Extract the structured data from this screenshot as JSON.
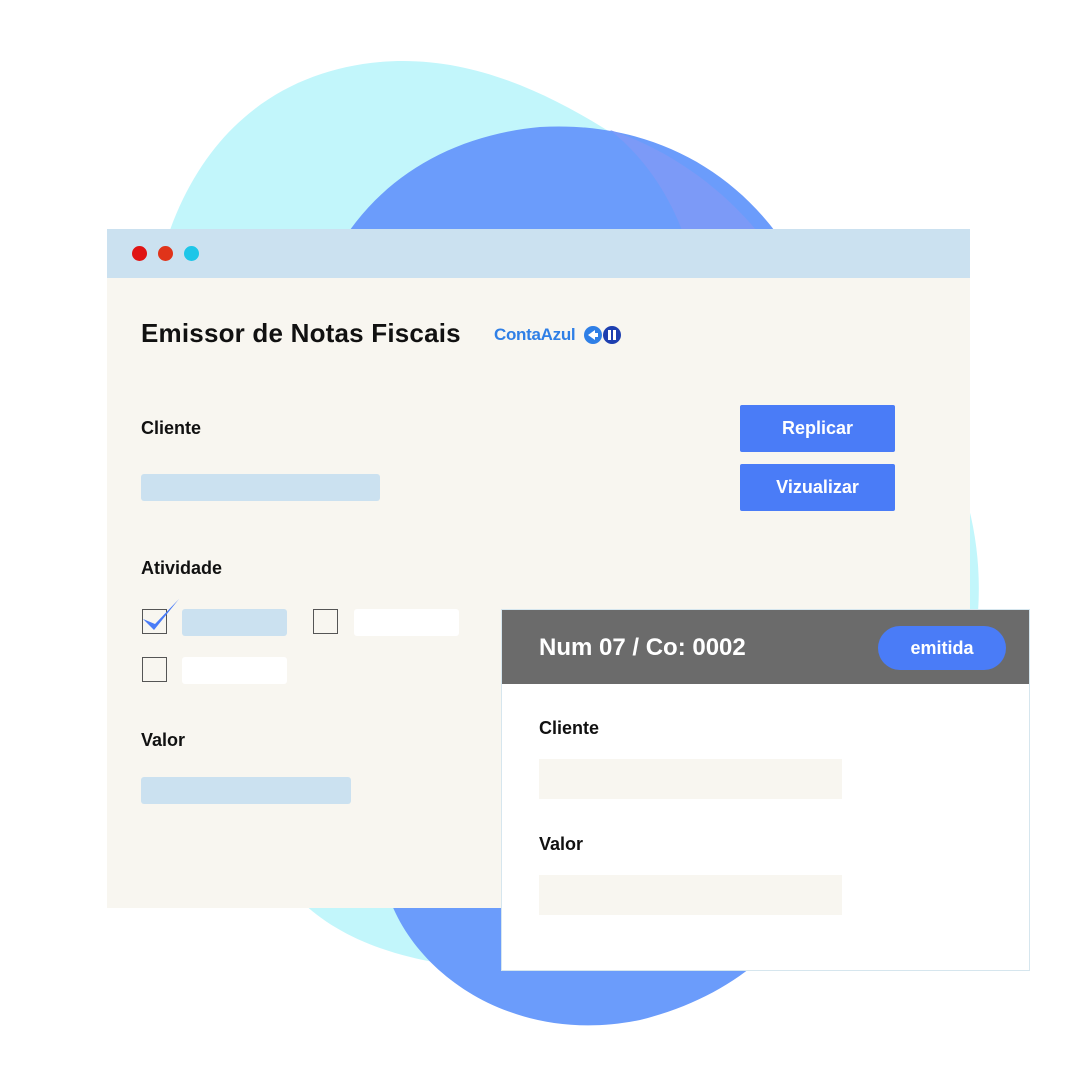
{
  "window": {
    "title": "Emissor de Notas Fiscais",
    "brand": "ContaAzul"
  },
  "form": {
    "cliente_label": "Cliente",
    "atividade_label": "Atividade",
    "valor_label": "Valor",
    "checkbox_1_checked": true,
    "checkbox_2_checked": false,
    "checkbox_3_checked": false
  },
  "actions": {
    "replicar": "Replicar",
    "vizualizar": "Vizualizar"
  },
  "invoice_card": {
    "title": "Num 07 / Co: 0002",
    "status": "emitida",
    "cliente_label": "Cliente",
    "valor_label": "Valor"
  },
  "colors": {
    "accent": "#4a7cf7",
    "titlebar": "#cbe1f0",
    "window_bg": "#f8f6f0",
    "card_header": "#6b6b6b"
  }
}
